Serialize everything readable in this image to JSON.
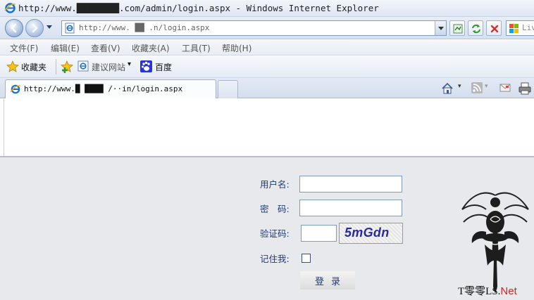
{
  "window": {
    "title": "http://www.████████.com/admin/login.aspx - Windows Internet Explorer"
  },
  "address_bar": {
    "url": "http://www.          ██      .n/login.aspx"
  },
  "search": {
    "placeholder": "Liv"
  },
  "menu": {
    "items": [
      "文件(F)",
      "编辑(E)",
      "查看(V)",
      "收藏夹(A)",
      "工具(T)",
      "帮助(H)"
    ]
  },
  "favorites_bar": {
    "favorites_label": "收藏夹",
    "suggested_sites": "建议网站",
    "baidu": "百度"
  },
  "tab": {
    "label": "http://www.█          ████ /··in/login.aspx"
  },
  "login_form": {
    "username_label": "用户名:",
    "password_label": "密　码:",
    "captcha_label": "验证码:",
    "remember_label": "记住我:",
    "captcha_text": "5mGdn",
    "submit_label": "登录",
    "username_value": "",
    "password_value": "",
    "captcha_value": "",
    "remember_checked": false
  },
  "watermark": {
    "text": "T零零LS.",
    "suffix": "Net"
  }
}
